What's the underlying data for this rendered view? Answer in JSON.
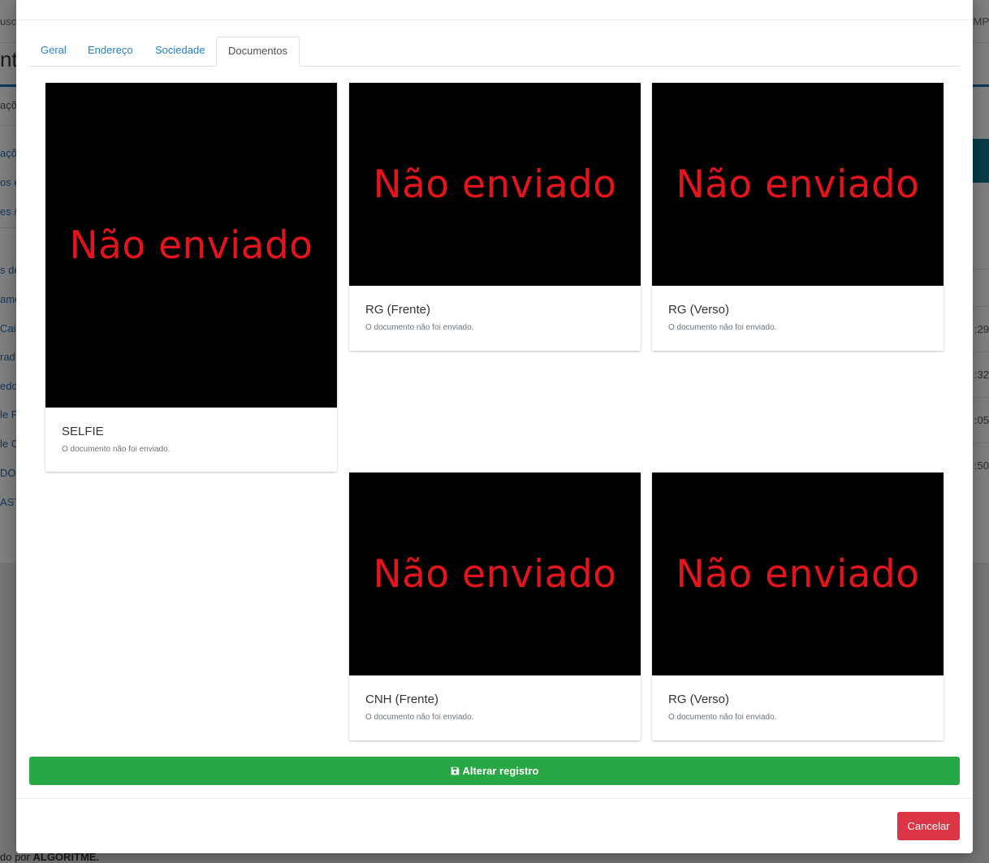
{
  "background": {
    "top_left": "usc",
    "top_right": "MP",
    "title": "nta",
    "side_items": [
      "açõ",
      "açõ",
      "os e",
      "es /",
      "s de",
      "ame",
      "Cai",
      "rad",
      "edo",
      "le F",
      "le C",
      "DOF",
      "ASTI"
    ],
    "right_times": [
      ":29",
      ":32",
      ":05",
      ":50"
    ],
    "footer_prefix": "do por ",
    "footer_brand": "ALGORITME."
  },
  "modal": {
    "tabs": [
      {
        "label": "Geral",
        "active": false
      },
      {
        "label": "Endereço",
        "active": false
      },
      {
        "label": "Sociedade",
        "active": false
      },
      {
        "label": "Documentos",
        "active": true
      }
    ],
    "documents": [
      {
        "image_text": "Não enviado",
        "title": "SELFIE",
        "status": "O documento não foi enviado."
      },
      {
        "image_text": "Não enviado",
        "title": "RG (Frente)",
        "status": "O documento não foi enviado."
      },
      {
        "image_text": "Não enviado",
        "title": "RG (Verso)",
        "status": "O documento não foi enviado."
      },
      {
        "image_text": "Não enviado",
        "title": "CNH (Frente)",
        "status": "O documento não foi enviado."
      },
      {
        "image_text": "Não enviado",
        "title": "RG (Verso)",
        "status": "O documento não foi enviado."
      }
    ],
    "save_button": {
      "label": "Alterar registro",
      "icon": "save-icon"
    },
    "cancel_button": {
      "label": "Cancelar"
    }
  },
  "colors": {
    "save": "#28a745",
    "cancel": "#dc3545",
    "tab_link": "#1f7fd0",
    "not_sent_text": "#e3141b"
  }
}
